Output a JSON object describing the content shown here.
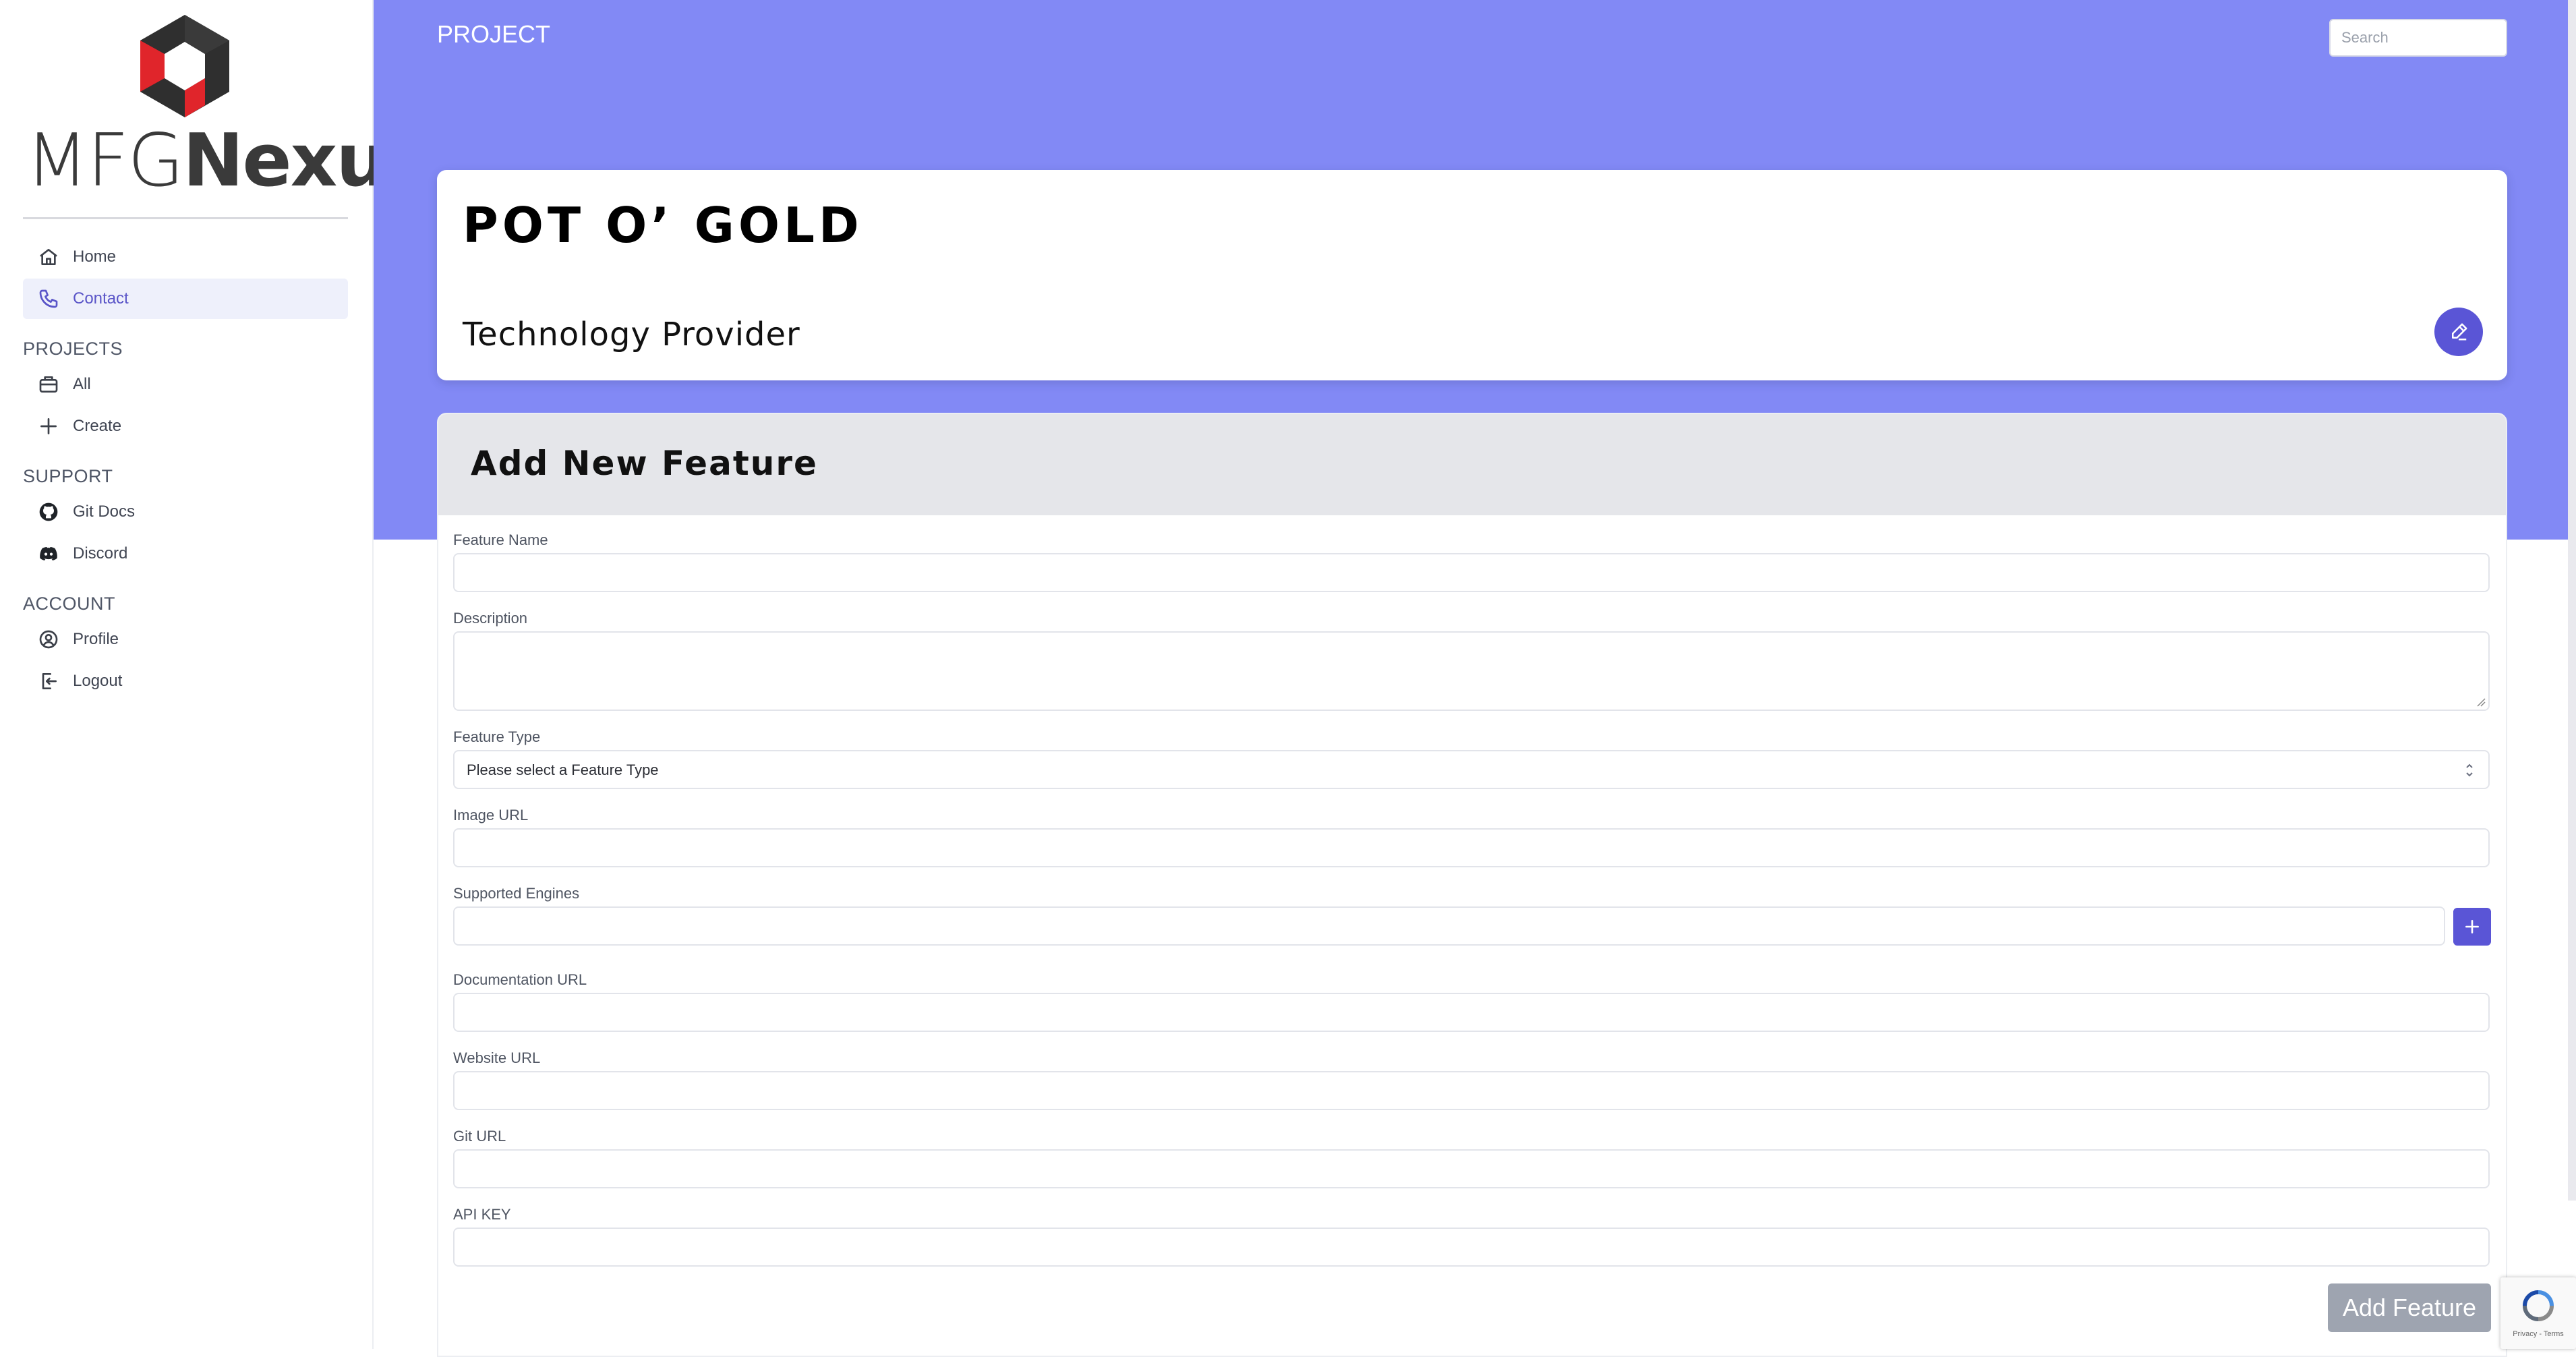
{
  "brand": {
    "name_light": "MFG",
    "name_bold": "Nexus"
  },
  "sidebar": {
    "home": "Home",
    "contact": "Contact",
    "sections": {
      "projects": {
        "title": "PROJECTS",
        "items": [
          "All",
          "Create"
        ]
      },
      "support": {
        "title": "SUPPORT",
        "items": [
          "Git Docs",
          "Discord"
        ]
      },
      "account": {
        "title": "ACCOUNT",
        "items": [
          "Profile",
          "Logout"
        ]
      }
    },
    "icons": [
      "home-icon",
      "phone-icon",
      "briefcase-icon",
      "plus-icon",
      "github-icon",
      "discord-icon",
      "user-circle-icon",
      "logout-icon"
    ]
  },
  "header": {
    "breadcrumb": "PROJECT",
    "search_placeholder": "Search"
  },
  "project": {
    "title": "Pot O’ Gold",
    "subtitle": "Technology Provider"
  },
  "form": {
    "title": "Add New Feature",
    "fields": {
      "feature_name": {
        "label": "Feature Name",
        "value": ""
      },
      "description": {
        "label": "Description",
        "value": ""
      },
      "feature_type": {
        "label": "Feature Type",
        "value": "Please select a Feature Type"
      },
      "image_url": {
        "label": "Image URL",
        "value": ""
      },
      "supported_engines": {
        "label": "Supported Engines",
        "value": ""
      },
      "documentation_url": {
        "label": "Documentation URL",
        "value": ""
      },
      "website_url": {
        "label": "Website URL",
        "value": ""
      },
      "git_url": {
        "label": "Git URL",
        "value": ""
      },
      "api_key": {
        "label": "API KEY",
        "value": ""
      }
    },
    "submit_label": "Add Feature"
  },
  "recaptcha": {
    "text": "Privacy - Terms"
  },
  "colors": {
    "banner": "#8289f5",
    "accent": "#5a55d6",
    "active_bg": "#eef0fb",
    "logo_dark": "#2f2f2f",
    "logo_red": "#e0252b",
    "submit_disabled": "#9ea4b0"
  }
}
